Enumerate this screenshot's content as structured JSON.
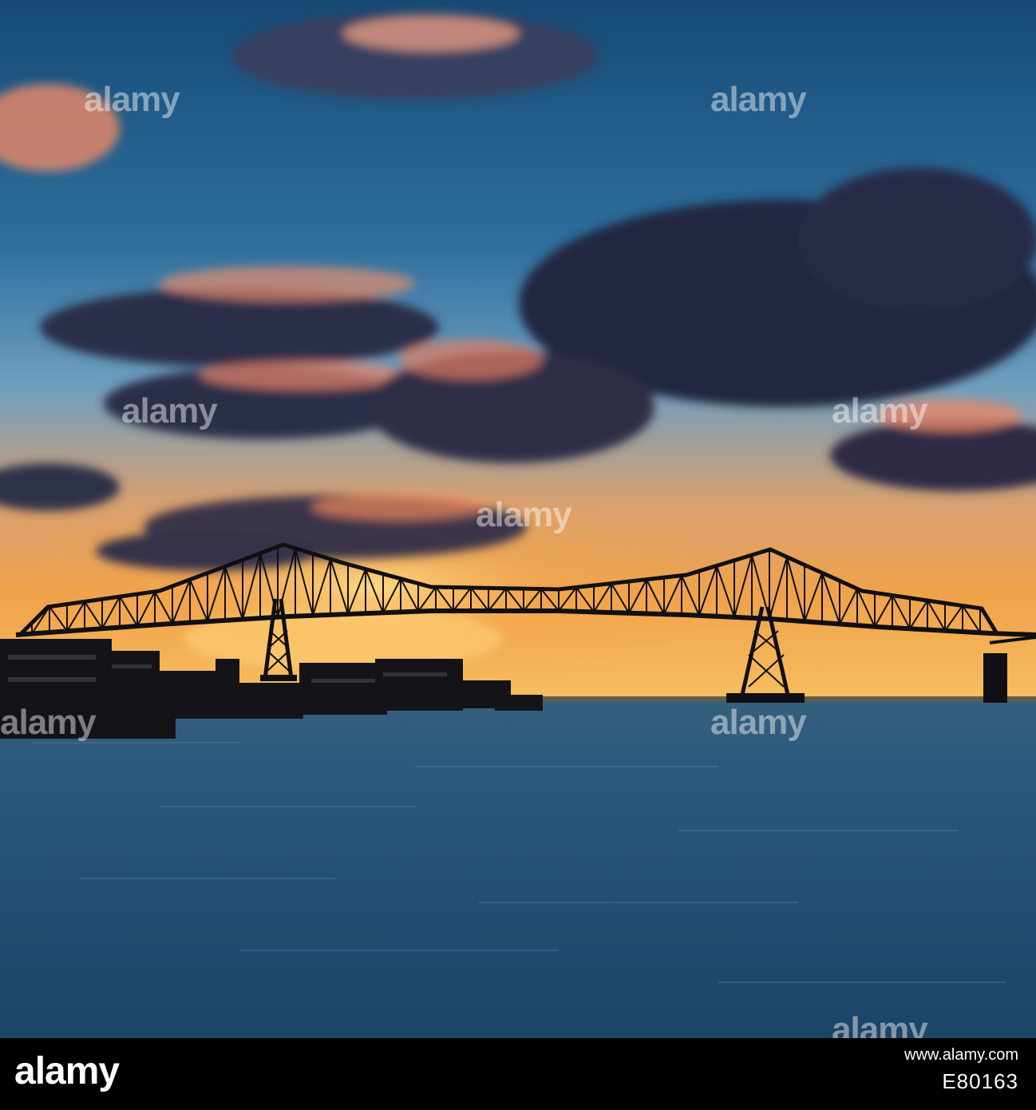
{
  "photo": {
    "watermark_text": "alamy",
    "colors": {
      "sky_top": "#1b4f7a",
      "sky_mid": "#3b7aa6",
      "horizon": "#f4b455",
      "sun": "#ffd27a",
      "cloud": "#2a2f4a",
      "cloud_lit": "#e88a6a",
      "water": "#244e72",
      "silhouette": "#0f0f14"
    }
  },
  "footer": {
    "logo": "alamy",
    "credit_line": "www.alamy.com",
    "image_id": "E80163"
  }
}
